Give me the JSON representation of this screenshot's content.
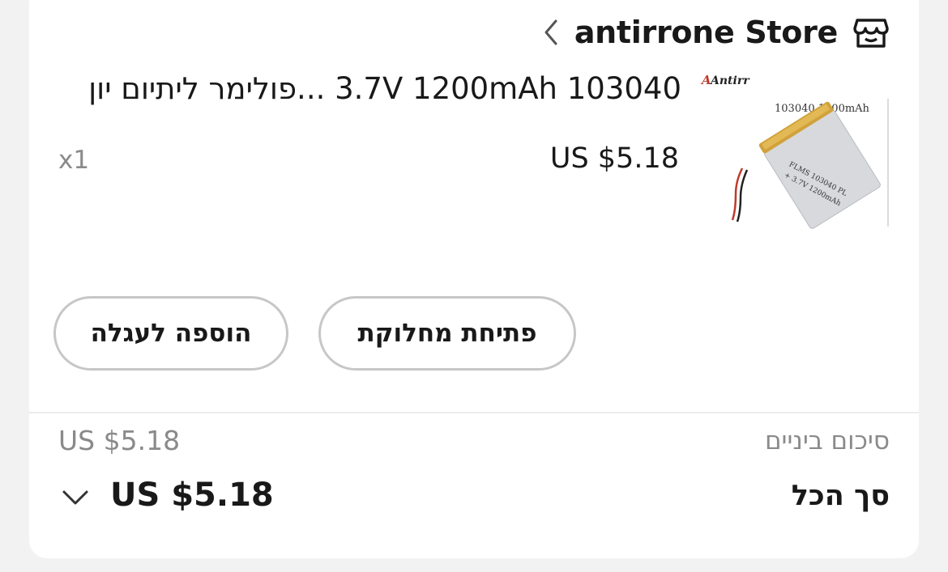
{
  "store": {
    "name": "antirrone Store",
    "icons": {
      "store": "store-icon",
      "chevron": "chevron-left-icon"
    }
  },
  "product": {
    "title": "3.7V 1200mAh 103040 ...פולימר ליתיום יון",
    "price": "US $5.18",
    "quantity": "x1",
    "image": {
      "brand": "Antirr",
      "label": "103040  1200mAh",
      "battery_lines": [
        "FLMS 103040 PL",
        "+ 3.7V 1200mAh"
      ]
    }
  },
  "buttons": {
    "open_shipment": "פתיחת מחלוקת",
    "add_to_cart": "הוספה לעגלה"
  },
  "summary": {
    "subtotal_label": "סיכום ביניים",
    "subtotal_value": "US $5.18",
    "total_label": "סך הכל",
    "total_value": "US $5.18",
    "expand_icon": "chevron-down-icon"
  },
  "colors": {
    "background": "#f2f2f2",
    "card": "#ffffff",
    "text": "#191919",
    "muted": "#8a8a8a",
    "button_border": "#c7c7c7"
  }
}
